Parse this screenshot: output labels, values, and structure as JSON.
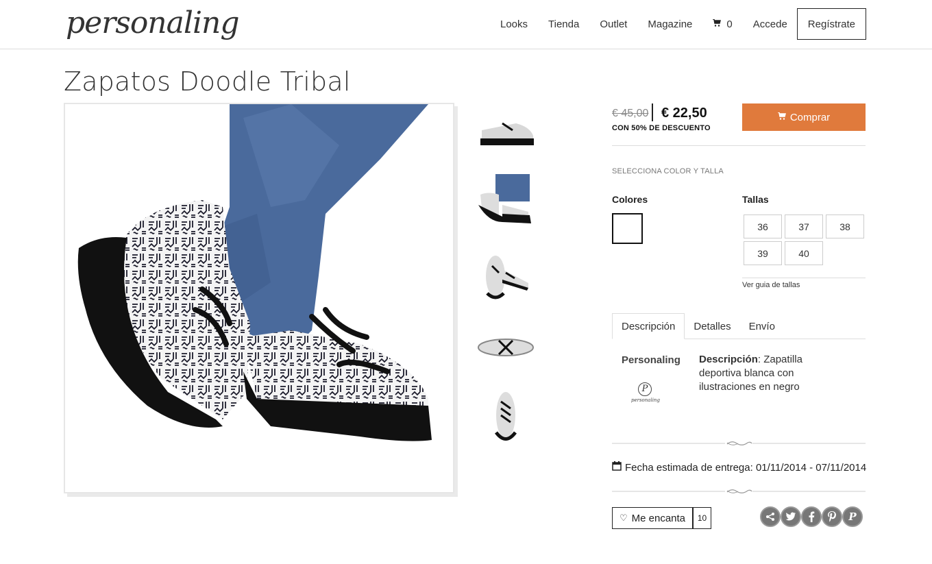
{
  "header": {
    "logo": "personaling",
    "nav": [
      "Looks",
      "Tienda",
      "Outlet",
      "Magazine"
    ],
    "cart_count": "0",
    "login": "Accede",
    "register": "Regístrate"
  },
  "product": {
    "title": "Zapatos Doodle Tribal",
    "price_old": "€ 45,00",
    "price_new": "€ 22,50",
    "discount": "CON 50% DE DESCUENTO",
    "buy_label": "Comprar",
    "select_label": "SELECCIONA COLOR Y TALLA",
    "colors_label": "Colores",
    "sizes_label": "Tallas",
    "sizes": [
      "36",
      "37",
      "38",
      "39",
      "40"
    ],
    "size_guide": "Ver guia de tallas"
  },
  "tabs": [
    "Descripción",
    "Detalles",
    "Envío"
  ],
  "description": {
    "brand": "Personaling",
    "brand_logo_text": "personaling",
    "label": "Descripción",
    "text": ": Zapatilla deportiva blanca con ilustraciones en negro"
  },
  "delivery": {
    "text": "Fecha estimada de entrega: 01/11/2014 - 07/11/2014"
  },
  "like": {
    "label": "Me encanta",
    "count": "10"
  },
  "colors": {
    "accent": "#e07a3c",
    "social": "#777777"
  },
  "social_icons": [
    "share-icon",
    "twitter-icon",
    "facebook-icon",
    "pinterest-icon",
    "personaling-icon"
  ]
}
